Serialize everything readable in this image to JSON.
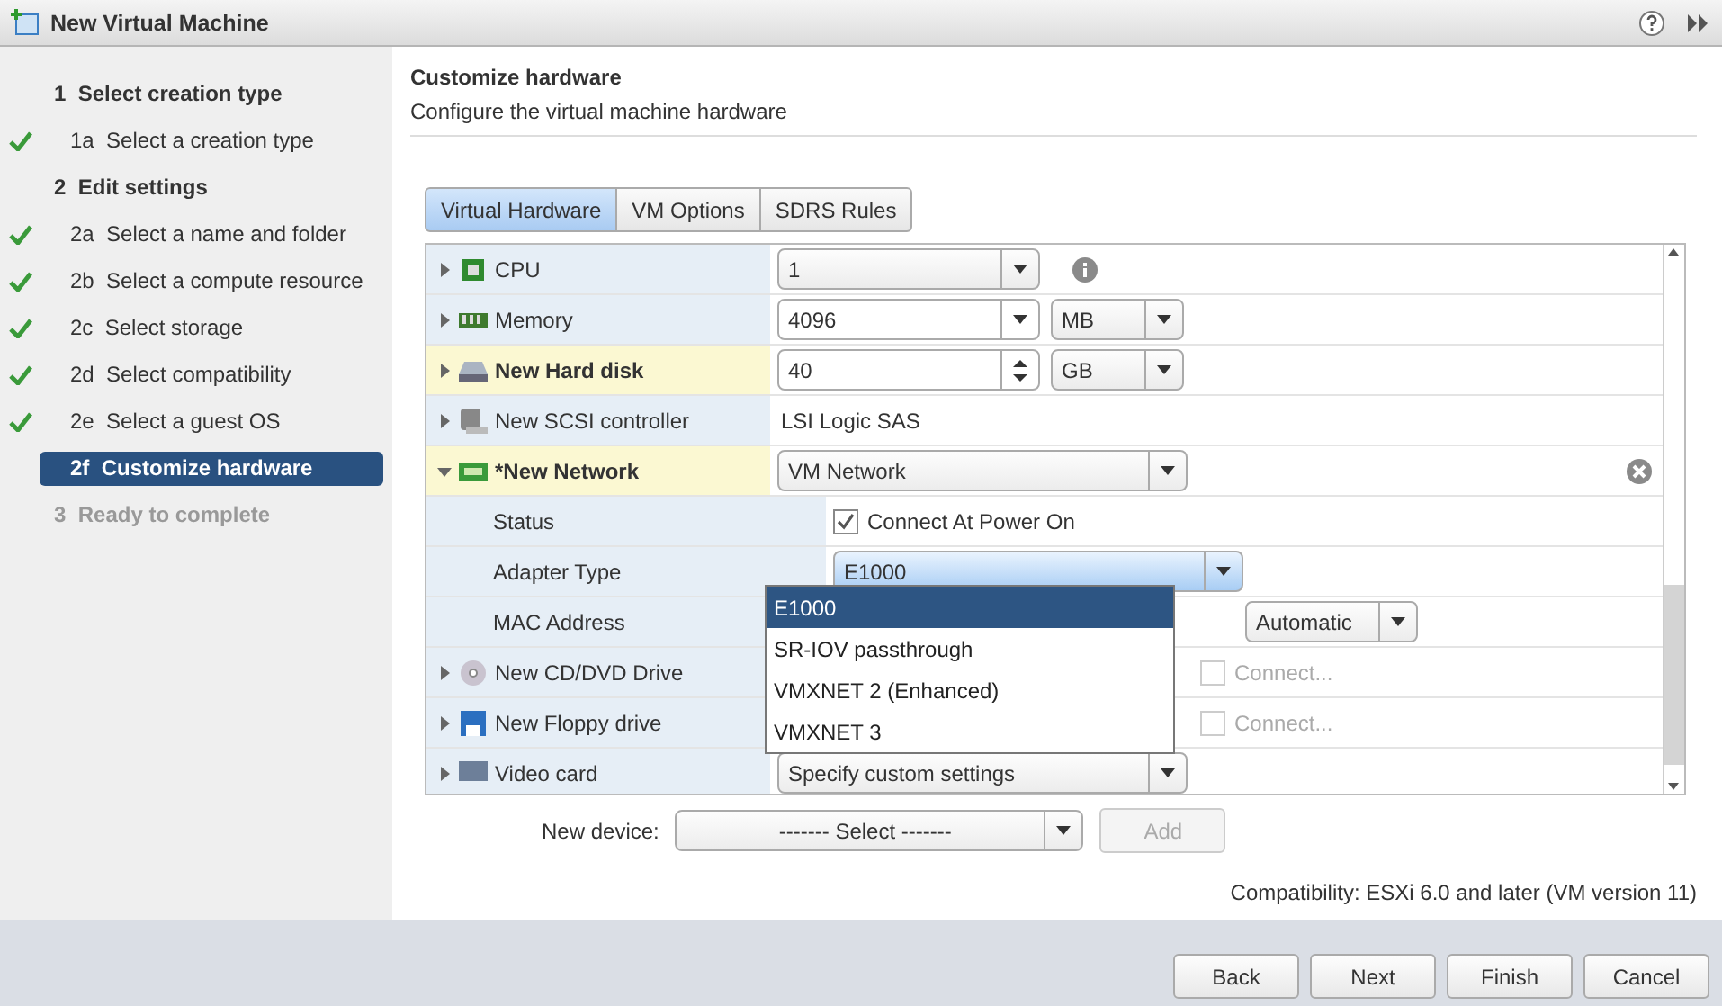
{
  "window": {
    "title": "New Virtual Machine"
  },
  "steps": [
    {
      "kind": "group",
      "number": "1",
      "label": "Select creation type",
      "done": false,
      "selected": false,
      "disabled": false
    },
    {
      "kind": "step",
      "number": "1a",
      "label": "Select a creation type",
      "done": true,
      "selected": false,
      "disabled": false
    },
    {
      "kind": "group",
      "number": "2",
      "label": "Edit settings",
      "done": false,
      "selected": false,
      "disabled": false
    },
    {
      "kind": "step",
      "number": "2a",
      "label": "Select a name and folder",
      "done": true,
      "selected": false,
      "disabled": false
    },
    {
      "kind": "step",
      "number": "2b",
      "label": "Select a compute resource",
      "done": true,
      "selected": false,
      "disabled": false
    },
    {
      "kind": "step",
      "number": "2c",
      "label": "Select storage",
      "done": true,
      "selected": false,
      "disabled": false
    },
    {
      "kind": "step",
      "number": "2d",
      "label": "Select compatibility",
      "done": true,
      "selected": false,
      "disabled": false
    },
    {
      "kind": "step",
      "number": "2e",
      "label": "Select a guest OS",
      "done": true,
      "selected": false,
      "disabled": false
    },
    {
      "kind": "step",
      "number": "2f",
      "label": "Customize hardware",
      "done": false,
      "selected": true,
      "disabled": false
    },
    {
      "kind": "group",
      "number": "3",
      "label": "Ready to complete",
      "done": false,
      "selected": false,
      "disabled": true
    }
  ],
  "header": {
    "title": "Customize hardware",
    "subtitle": "Configure the virtual machine hardware"
  },
  "tabs": [
    {
      "label": "Virtual Hardware",
      "selected": true
    },
    {
      "label": "VM Options",
      "selected": false
    },
    {
      "label": "SDRS Rules",
      "selected": false
    }
  ],
  "hardware": [
    {
      "kind": "device",
      "label": "CPU",
      "expanded": false,
      "modified": false,
      "value": {
        "kind": "select",
        "text": "1"
      },
      "info": true
    },
    {
      "kind": "device",
      "label": "Memory",
      "expanded": false,
      "modified": false,
      "value": {
        "kind": "combo",
        "text": "4096"
      },
      "unit": "MB"
    },
    {
      "kind": "device",
      "label": "New Hard disk",
      "expanded": false,
      "modified": true,
      "value": {
        "kind": "spinner",
        "text": "40"
      },
      "unit": "GB"
    },
    {
      "kind": "device",
      "label": "New SCSI controller",
      "expanded": false,
      "modified": false,
      "value": {
        "kind": "text",
        "text": "LSI Logic SAS"
      }
    },
    {
      "kind": "device",
      "label": "*New Network",
      "expanded": true,
      "modified": true,
      "value": {
        "kind": "select",
        "text": "VM Network"
      },
      "removable": true
    },
    {
      "kind": "property",
      "label": "Status",
      "value": {
        "kind": "checkbox",
        "text": "Connect At Power On",
        "checked": true,
        "disabled": false
      }
    },
    {
      "kind": "property",
      "label": "Adapter Type",
      "value": {
        "kind": "select",
        "text": "E1000",
        "open": true
      }
    },
    {
      "kind": "property",
      "label": "MAC Address",
      "unit": "Automatic"
    },
    {
      "kind": "device",
      "label": "New CD/DVD Drive",
      "expanded": false,
      "modified": false,
      "extra": {
        "text": "Connect...",
        "checked": false,
        "disabled": true
      }
    },
    {
      "kind": "device",
      "label": "New Floppy drive",
      "expanded": false,
      "modified": false,
      "extra": {
        "text": "Connect...",
        "checked": false,
        "disabled": true
      }
    },
    {
      "kind": "device",
      "label": "Video card",
      "expanded": false,
      "modified": false,
      "value": {
        "kind": "select",
        "text": "Specify custom settings"
      }
    }
  ],
  "adapter_menu": [
    {
      "label": "E1000",
      "selected": true
    },
    {
      "label": "SR-IOV passthrough",
      "selected": false
    },
    {
      "label": "VMXNET 2 (Enhanced)",
      "selected": false
    },
    {
      "label": "VMXNET 3",
      "selected": false
    }
  ],
  "new_device": {
    "label": "New device:",
    "select": "------- Select -------",
    "add": {
      "label": "Add",
      "disabled": true
    }
  },
  "compatibility": "Compatibility: ESXi 6.0 and later (VM version 11)",
  "buttons": [
    {
      "label": "Back",
      "disabled": false
    },
    {
      "label": "Next",
      "disabled": false
    },
    {
      "label": "Finish",
      "disabled": false
    },
    {
      "label": "Cancel",
      "disabled": false
    }
  ]
}
